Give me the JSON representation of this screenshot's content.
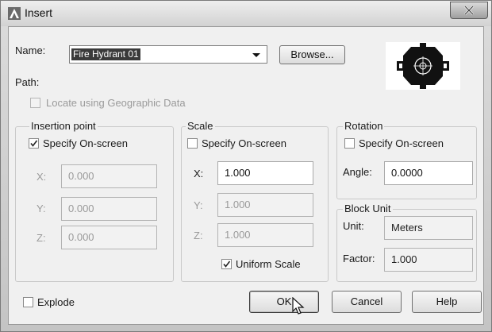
{
  "window": {
    "title": "Insert",
    "close_icon": "close-x-icon",
    "app_icon": "autocad-a-icon"
  },
  "name_row": {
    "label": "Name:",
    "value": "Fire Hydrant 01",
    "browse_label": "Browse..."
  },
  "path": {
    "label": "Path:"
  },
  "geo": {
    "label": "Locate using Geographic Data",
    "checked": false,
    "enabled": false
  },
  "insertion": {
    "title": "Insertion point",
    "specify_label": "Specify On-screen",
    "specify_checked": true,
    "x_label": "X:",
    "x_value": "0.000",
    "y_label": "Y:",
    "y_value": "0.000",
    "z_label": "Z:",
    "z_value": "0.000"
  },
  "scale": {
    "title": "Scale",
    "specify_label": "Specify On-screen",
    "specify_checked": false,
    "x_label": "X:",
    "x_value": "1.000",
    "y_label": "Y:",
    "y_value": "1.000",
    "z_label": "Z:",
    "z_value": "1.000",
    "uniform_label": "Uniform Scale",
    "uniform_checked": true
  },
  "rotation": {
    "title": "Rotation",
    "specify_label": "Specify On-screen",
    "specify_checked": false,
    "angle_label": "Angle:",
    "angle_value": "0.0000"
  },
  "block_unit": {
    "title": "Block Unit",
    "unit_label": "Unit:",
    "unit_value": "Meters",
    "factor_label": "Factor:",
    "factor_value": "1.000"
  },
  "explode": {
    "label": "Explode",
    "checked": false
  },
  "buttons": {
    "ok": "OK",
    "cancel": "Cancel",
    "help": "Help"
  },
  "colors": {
    "accent_text_bg": "#3a3a3a",
    "window_bg": "#f0f0f0"
  }
}
